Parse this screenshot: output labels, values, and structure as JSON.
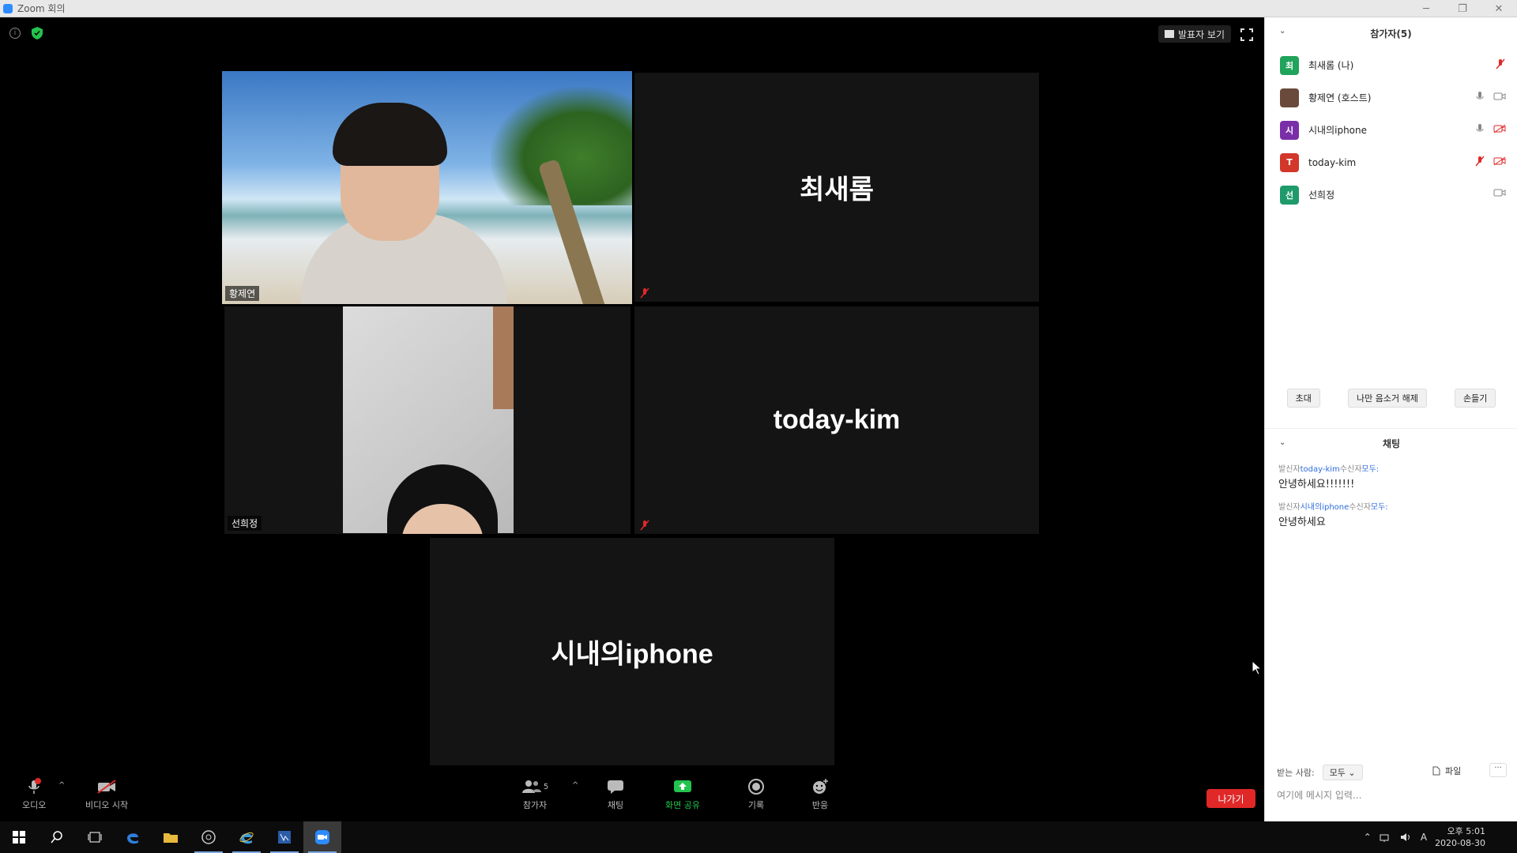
{
  "window": {
    "title": "Zoom 회의"
  },
  "stage": {
    "speaker_view_label": "발표자 보기",
    "tiles": [
      {
        "type": "video",
        "name": "황제연"
      },
      {
        "type": "name",
        "name": "최새롬"
      },
      {
        "type": "video",
        "name": "선희정"
      },
      {
        "type": "name",
        "name": "today-kim"
      },
      {
        "type": "name",
        "name": "시내의iphone"
      }
    ]
  },
  "toolbar": {
    "audio": "오디오",
    "video": "비디오 시작",
    "participants": "참가자",
    "participants_count": "5",
    "chat": "채팅",
    "share": "화면 공유",
    "record": "기록",
    "reactions": "반응",
    "leave": "나가기"
  },
  "participants_panel": {
    "title": "참가자(5)",
    "list": [
      {
        "name": "최새롬 (나)",
        "initial": "최",
        "color": "#20a35a"
      },
      {
        "name": "황제연 (호스트)",
        "initial": "",
        "color": "#6a4a3a"
      },
      {
        "name": "시내의iphone",
        "initial": "시",
        "color": "#7a2fa8"
      },
      {
        "name": "today-kim",
        "initial": "T",
        "color": "#d2372a"
      },
      {
        "name": "선희정",
        "initial": "선",
        "color": "#1f9a6a"
      }
    ],
    "actions": {
      "invite": "초대",
      "unmute_me": "나만 음소거 해제",
      "raise_hand": "손들기"
    }
  },
  "chat": {
    "title": "채팅",
    "messages": [
      {
        "prefix": "발신자",
        "sender": "today-kim",
        "mid": "수신자",
        "to": "모두:",
        "text": "안녕하세요!!!!!!!"
      },
      {
        "prefix": "발신자",
        "sender": "시내의iphone",
        "mid": "수신자",
        "to": "모두:",
        "text": "안녕하세요"
      }
    ],
    "to_label": "받는 사람:",
    "to_value": "모두",
    "file_label": "파일",
    "more_label": "···",
    "input_placeholder": "여기에 메시지 입력..."
  },
  "taskbar": {
    "time": "오후 5:01",
    "date": "2020-08-30",
    "tray_text": "A"
  },
  "colors": {
    "leave": "#e02828",
    "share": "#23c34d",
    "active_border": "#b7d36a"
  }
}
